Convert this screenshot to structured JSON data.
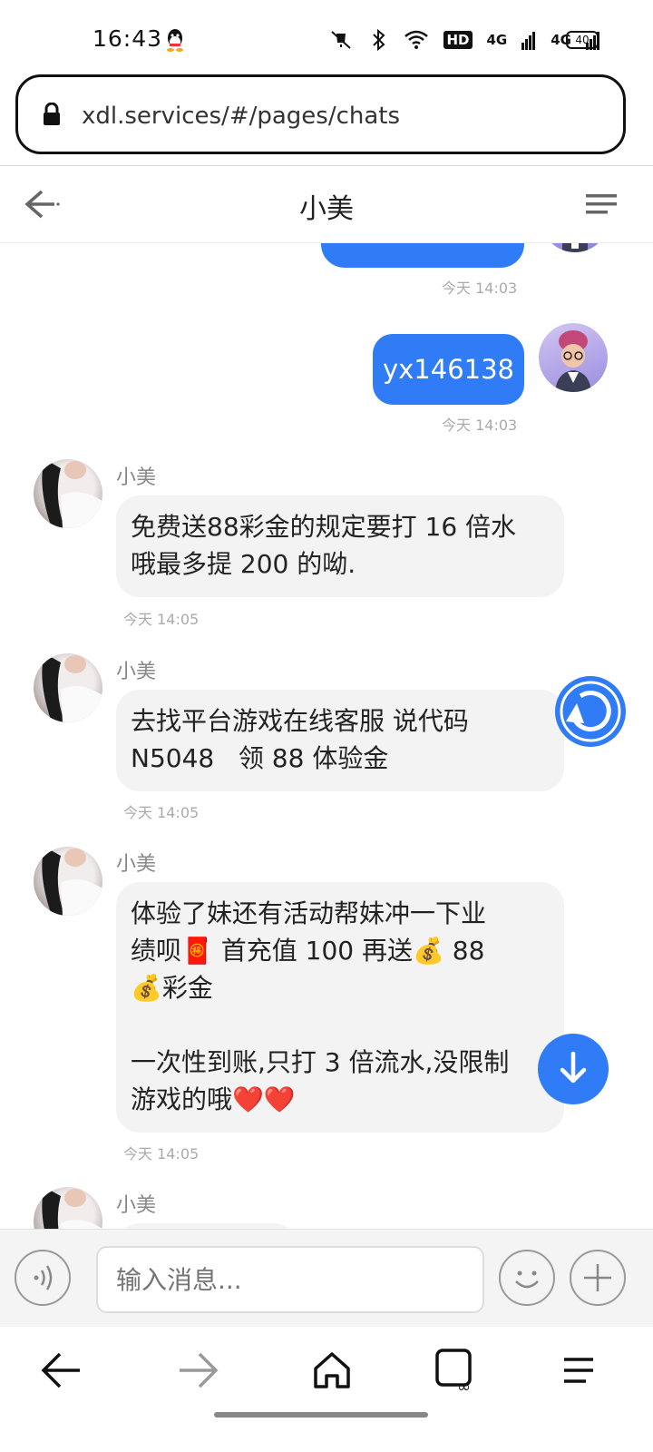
{
  "status_bar": {
    "time": "16:43",
    "network_1": "4G",
    "network_2": "4G",
    "hd_label": "HD",
    "battery": "40"
  },
  "address_bar": {
    "url": "xdl.services/#/pages/chats"
  },
  "nav": {
    "title": "小美"
  },
  "messages": [
    {
      "type": "outgoing-partial",
      "timestamp": "今天 14:03"
    },
    {
      "type": "outgoing",
      "text": "yx146138",
      "timestamp": "今天 14:03"
    },
    {
      "type": "incoming",
      "sender": "小美",
      "text": "免费送88彩金的规定要打 16 倍水\n哦最多提 200 的呦.",
      "timestamp": "今天 14:05"
    },
    {
      "type": "incoming",
      "sender": "小美",
      "text": "去找平台游戏在线客服 说代码\nN5048   领 88 体验金",
      "timestamp": "今天 14:05"
    },
    {
      "type": "incoming",
      "sender": "小美",
      "text": "体验了妹还有活动帮妹冲一下业\n绩呗🧧 首充值 100 再送💰 88\n💰彩金\n\n一次性到账,只打 3 倍流水,没限制\n游戏的哦❤️❤️",
      "timestamp": "今天 14:05"
    },
    {
      "type": "incoming-partial",
      "sender": "小美"
    }
  ],
  "composer": {
    "placeholder": "输入消息..."
  },
  "icons": {
    "back": "arrow-left-icon",
    "menu": "menu-icon",
    "lock": "lock-icon",
    "voice": "voice-icon",
    "emoji": "emoji-icon",
    "plus": "plus-icon",
    "refresh": "refresh-icon",
    "scroll_down": "arrow-down-icon"
  },
  "colors": {
    "accent": "#2f7cf6",
    "incoming_bubble": "#f3f3f3"
  }
}
